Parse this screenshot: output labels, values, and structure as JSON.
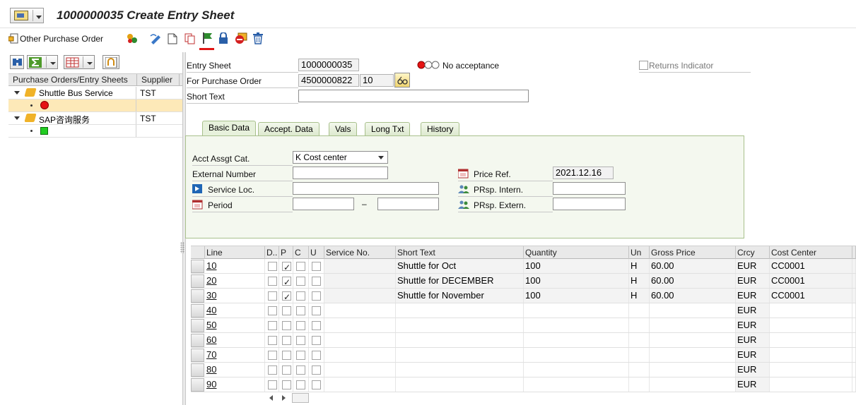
{
  "window": {
    "title": "1000000035 Create Entry Sheet"
  },
  "toolbar": {
    "other_po_label": "Other Purchase Order"
  },
  "tree": {
    "columns": [
      "Purchase Orders/Entry Sheets",
      "Supplier"
    ],
    "rows": [
      {
        "label": "Shuttle Bus Service",
        "supplier": "TST"
      },
      {
        "label": "",
        "supplier": ""
      },
      {
        "label": "SAP咨询服务",
        "supplier": "TST"
      },
      {
        "label": "",
        "supplier": ""
      }
    ]
  },
  "header": {
    "entry_sheet_label": "Entry Sheet",
    "entry_sheet_value": "1000000035",
    "acceptance_status": "No acceptance",
    "returns_indicator_label": "Returns Indicator",
    "returns_indicator_checked": false,
    "po_label": "For Purchase Order",
    "po_number": "4500000822",
    "po_item": "10",
    "short_text_label": "Short Text",
    "short_text_value": ""
  },
  "tabs": [
    {
      "label": "Basic Data",
      "active": true
    },
    {
      "label": "Accept. Data",
      "active": false
    },
    {
      "label": "Vals",
      "active": false
    },
    {
      "label": "Long Txt",
      "active": false
    },
    {
      "label": "History",
      "active": false
    }
  ],
  "basic_data": {
    "acct_assgt_cat_label": "Acct Assgt Cat.",
    "acct_assgt_cat_value": "K Cost center",
    "external_number_label": "External Number",
    "external_number_value": "",
    "service_loc_label": "Service Loc.",
    "service_loc_value": "",
    "period_label": "Period",
    "period_from": "",
    "period_dash": "–",
    "period_to": "",
    "price_ref_label": "Price Ref.",
    "price_ref_value": "2021.12.16",
    "prsp_intern_label": "PRsp. Intern.",
    "prsp_intern_value": "",
    "prsp_extern_label": "PRsp. Extern.",
    "prsp_extern_value": ""
  },
  "grid": {
    "columns": {
      "line": "Line",
      "d": "D..",
      "p": "P",
      "c": "C",
      "u": "U",
      "service_no": "Service No.",
      "short_text": "Short Text",
      "quantity": "Quantity",
      "unit": "Un",
      "gross_price": "Gross Price",
      "currency": "Crcy",
      "cost_center": "Cost Center"
    },
    "rows": [
      {
        "line": "10",
        "d": false,
        "p": true,
        "c": false,
        "u": false,
        "service_no": "",
        "short_text": "Shuttle for Oct",
        "quantity": "100",
        "unit": "H",
        "gross_price": "60.00",
        "currency": "EUR",
        "cost_center": "CC0001",
        "filled": true
      },
      {
        "line": "20",
        "d": false,
        "p": true,
        "c": false,
        "u": false,
        "service_no": "",
        "short_text": "Shuttle for DECEMBER",
        "quantity": "100",
        "unit": "H",
        "gross_price": "60.00",
        "currency": "EUR",
        "cost_center": "CC0001",
        "filled": true
      },
      {
        "line": "30",
        "d": false,
        "p": true,
        "c": false,
        "u": false,
        "service_no": "",
        "short_text": "Shuttle for November",
        "quantity": "100",
        "unit": "H",
        "gross_price": "60.00",
        "currency": "EUR",
        "cost_center": "CC0001",
        "filled": true
      },
      {
        "line": "40",
        "d": false,
        "p": false,
        "c": false,
        "u": false,
        "service_no": "",
        "short_text": "",
        "quantity": "",
        "unit": "",
        "gross_price": "",
        "currency": "EUR",
        "cost_center": "",
        "filled": false
      },
      {
        "line": "50",
        "d": false,
        "p": false,
        "c": false,
        "u": false,
        "service_no": "",
        "short_text": "",
        "quantity": "",
        "unit": "",
        "gross_price": "",
        "currency": "EUR",
        "cost_center": "",
        "filled": false
      },
      {
        "line": "60",
        "d": false,
        "p": false,
        "c": false,
        "u": false,
        "service_no": "",
        "short_text": "",
        "quantity": "",
        "unit": "",
        "gross_price": "",
        "currency": "EUR",
        "cost_center": "",
        "filled": false
      },
      {
        "line": "70",
        "d": false,
        "p": false,
        "c": false,
        "u": false,
        "service_no": "",
        "short_text": "",
        "quantity": "",
        "unit": "",
        "gross_price": "",
        "currency": "EUR",
        "cost_center": "",
        "filled": false
      },
      {
        "line": "80",
        "d": false,
        "p": false,
        "c": false,
        "u": false,
        "service_no": "",
        "short_text": "",
        "quantity": "",
        "unit": "",
        "gross_price": "",
        "currency": "EUR",
        "cost_center": "",
        "filled": false
      },
      {
        "line": "90",
        "d": false,
        "p": false,
        "c": false,
        "u": false,
        "service_no": "",
        "short_text": "",
        "quantity": "",
        "unit": "",
        "gross_price": "",
        "currency": "EUR",
        "cost_center": "",
        "filled": false
      }
    ]
  },
  "colors": {
    "tab_border": "#a8c08c",
    "tab_body": "#f4f8ef",
    "selection": "#fde9b8",
    "status_red": "#e61414",
    "status_green": "#22cc22",
    "flag_green": "#2e8b2e"
  }
}
